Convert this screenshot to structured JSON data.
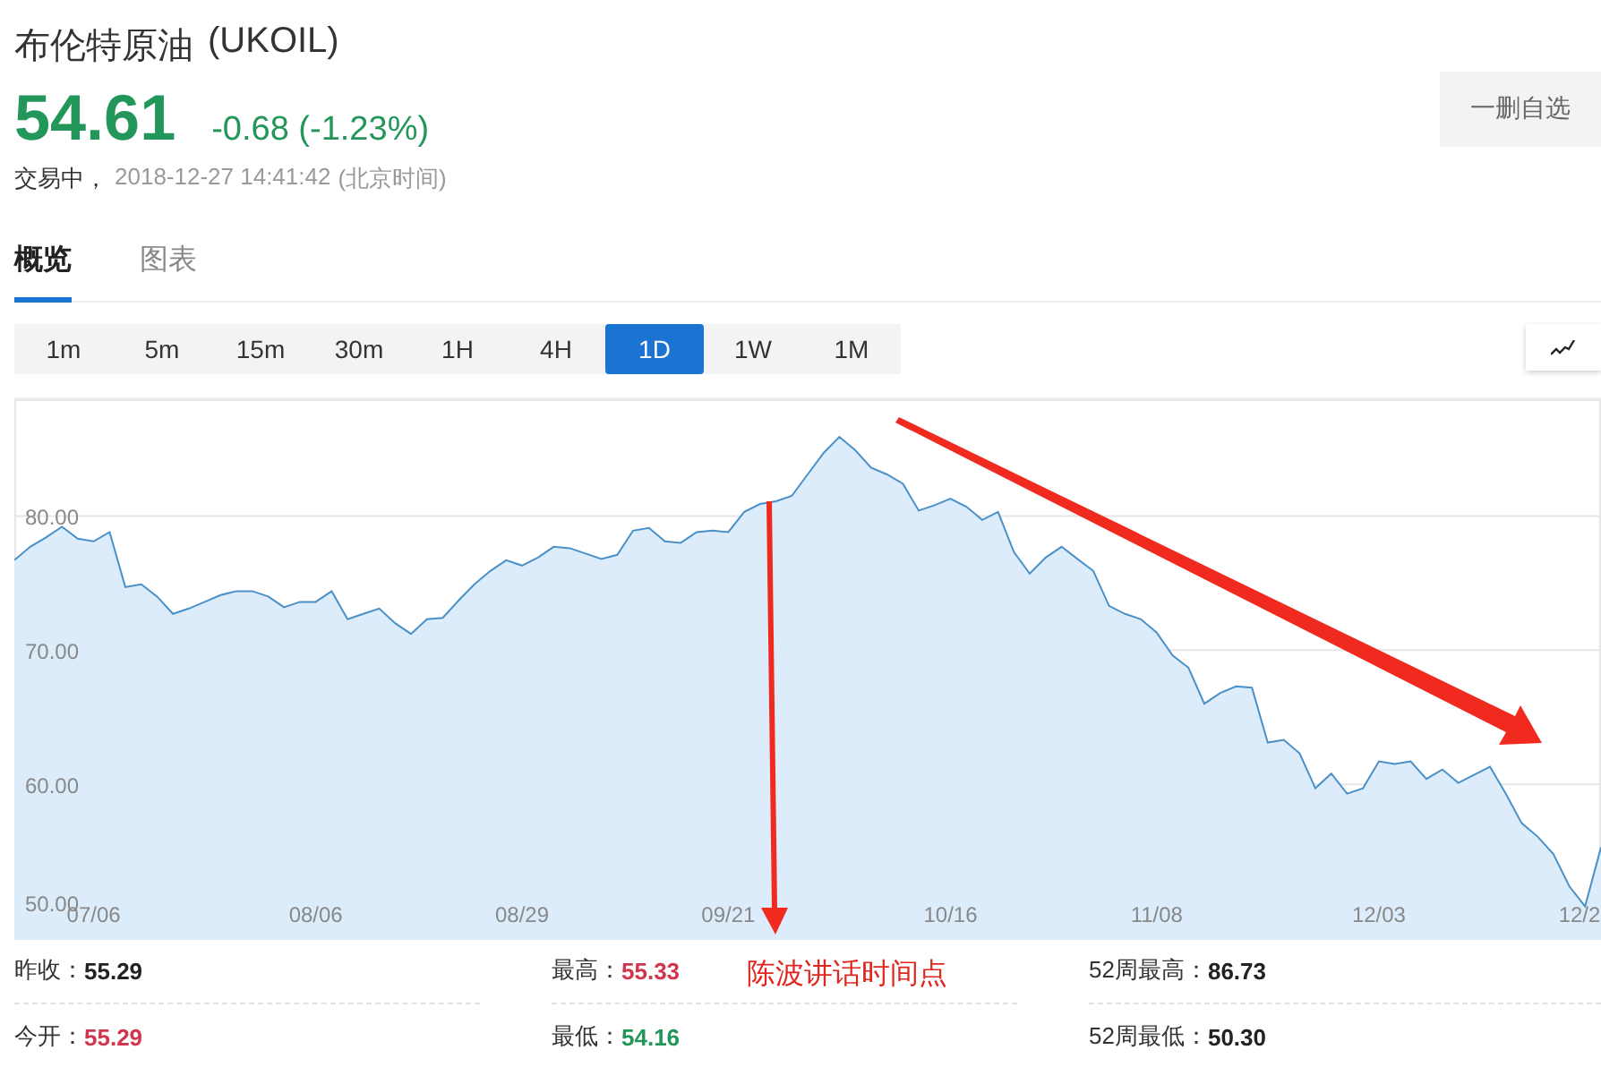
{
  "header": {
    "name": "布伦特原油",
    "symbol": "(UKOIL)",
    "price": "54.61",
    "change": "-0.68 (-1.23%)",
    "color": "#23965a",
    "status": "交易中，",
    "time": "2018-12-27 14:41:42",
    "timezone": "(北京时间)",
    "watch_button": "一删自选"
  },
  "tabs": [
    {
      "label": "概览",
      "selected": true
    },
    {
      "label": "图表",
      "selected": false
    }
  ],
  "periods": [
    {
      "label": "1m",
      "selected": false
    },
    {
      "label": "5m",
      "selected": false
    },
    {
      "label": "15m",
      "selected": false
    },
    {
      "label": "30m",
      "selected": false
    },
    {
      "label": "1H",
      "selected": false
    },
    {
      "label": "4H",
      "selected": false
    },
    {
      "label": "1D",
      "selected": true
    },
    {
      "label": "1W",
      "selected": false
    },
    {
      "label": "1M",
      "selected": false
    }
  ],
  "chart": {
    "chart_data": {
      "type": "area",
      "grid": true,
      "ylim": [
        48.4,
        88.7
      ],
      "yticks": [
        {
          "value": 80,
          "label": "80.00"
        },
        {
          "value": 70,
          "label": "70.00"
        },
        {
          "value": 60,
          "label": "60.00"
        },
        {
          "value": 50,
          "label": "50.00"
        }
      ],
      "categories": [
        null,
        null,
        null,
        null,
        null,
        "07/06",
        null,
        null,
        null,
        null,
        null,
        null,
        null,
        null,
        null,
        null,
        null,
        null,
        null,
        "08/06",
        null,
        null,
        null,
        null,
        null,
        null,
        null,
        null,
        null,
        null,
        null,
        null,
        "08/29",
        null,
        null,
        null,
        null,
        null,
        null,
        null,
        null,
        null,
        null,
        null,
        null,
        "09/21",
        null,
        null,
        null,
        null,
        null,
        null,
        null,
        null,
        null,
        null,
        null,
        null,
        null,
        "10/16",
        null,
        null,
        null,
        null,
        null,
        null,
        null,
        null,
        null,
        null,
        null,
        null,
        "11/08",
        null,
        null,
        null,
        null,
        null,
        null,
        null,
        null,
        null,
        null,
        null,
        null,
        null,
        "12/03",
        null,
        null,
        null,
        null,
        null,
        null,
        null,
        null,
        null,
        null,
        null,
        null,
        "12/2",
        null
      ],
      "series": [
        {
          "color": "#4a90c8",
          "values": [
            76.7,
            77.7,
            78.4,
            79.2,
            78.3,
            78.1,
            78.8,
            74.7,
            74.9,
            74.0,
            72.7,
            73.1,
            73.6,
            74.1,
            74.4,
            74.4,
            74.0,
            73.2,
            73.6,
            73.6,
            74.4,
            72.3,
            72.7,
            73.1,
            72.0,
            71.2,
            72.3,
            72.4,
            73.7,
            74.9,
            75.9,
            76.7,
            76.3,
            76.9,
            77.7,
            77.6,
            77.2,
            76.8,
            77.1,
            78.9,
            79.1,
            78.1,
            78.0,
            78.8,
            78.9,
            78.8,
            80.3,
            80.9,
            81.1,
            81.5,
            83.1,
            84.7,
            85.9,
            84.9,
            83.6,
            83.1,
            82.4,
            80.4,
            80.8,
            81.3,
            80.7,
            79.7,
            80.3,
            77.3,
            75.7,
            76.9,
            77.7,
            76.8,
            75.9,
            73.3,
            72.7,
            72.3,
            71.3,
            69.6,
            68.7,
            66.0,
            66.8,
            67.3,
            67.2,
            63.1,
            63.3,
            62.3,
            59.7,
            60.8,
            59.3,
            59.7,
            61.7,
            61.5,
            61.7,
            60.4,
            61.1,
            60.1,
            60.7,
            61.3,
            59.3,
            57.1,
            56.1,
            54.8,
            52.4,
            50.9,
            55.3
          ]
        }
      ]
    }
  },
  "annotation": {
    "label": "陈波讲话时间点"
  },
  "stats": [
    {
      "label": "昨收：",
      "value": "55.29",
      "color": "#222222"
    },
    {
      "label": "最高：",
      "value": "55.33",
      "color": "#d0364d"
    },
    {
      "label": "52周最高：",
      "value": "86.73",
      "color": "#222222"
    },
    {
      "label": "今开：",
      "value": "55.29",
      "color": "#d0364d"
    },
    {
      "label": "最低：",
      "value": "54.16",
      "color": "#23965a"
    },
    {
      "label": "52周最低：",
      "value": "50.30",
      "color": "#222222"
    }
  ]
}
